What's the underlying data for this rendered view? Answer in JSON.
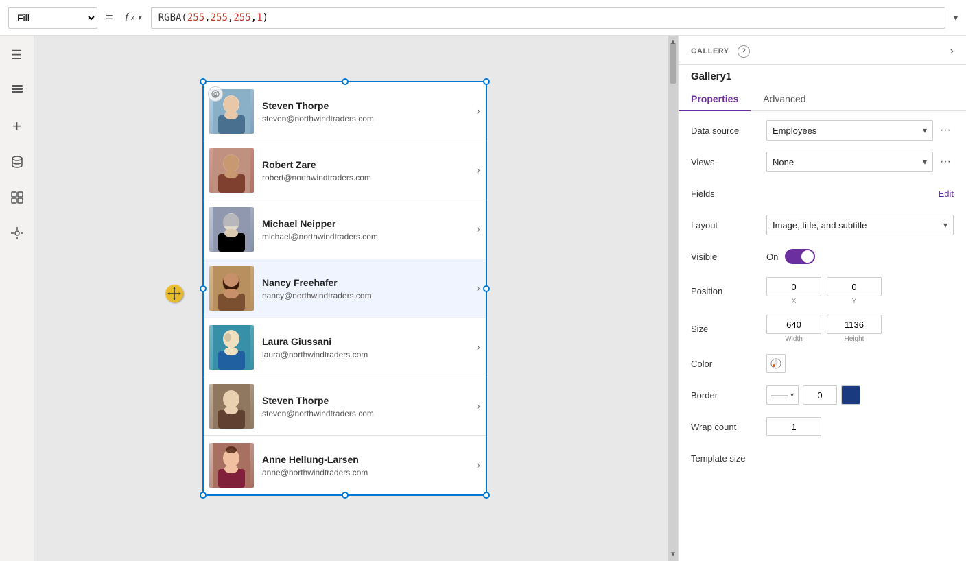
{
  "toolbar": {
    "fill_label": "Fill",
    "equals_symbol": "=",
    "fx_label": "fx",
    "formula": "RGBA(255, 255, 255, 1)",
    "formula_parts": [
      "RGBA(",
      "255",
      ", ",
      "255",
      ", ",
      "255",
      ", ",
      "1",
      ")"
    ],
    "dropdown_arrow": "▾"
  },
  "sidebar": {
    "icons": [
      {
        "name": "hamburger-icon",
        "symbol": "☰"
      },
      {
        "name": "layers-icon",
        "symbol": "⊞"
      },
      {
        "name": "plus-icon",
        "symbol": "+"
      },
      {
        "name": "database-icon",
        "symbol": "🗄"
      },
      {
        "name": "components-icon",
        "symbol": "⊡"
      },
      {
        "name": "tools-icon",
        "symbol": "🔧"
      }
    ]
  },
  "gallery": {
    "items": [
      {
        "name": "Steven Thorpe",
        "email": "steven@northwindtraders.com",
        "avatar_color": "avatar-1"
      },
      {
        "name": "Robert Zare",
        "email": "robert@northwindtraders.com",
        "avatar_color": "avatar-2"
      },
      {
        "name": "Michael Neipper",
        "email": "michael@northwindtraders.com",
        "avatar_color": "avatar-3"
      },
      {
        "name": "Nancy Freehafer",
        "email": "nancy@northwindtraders.com",
        "avatar_color": "avatar-4",
        "selected": true
      },
      {
        "name": "Laura Giussani",
        "email": "laura@northwindtraders.com",
        "avatar_color": "avatar-5"
      },
      {
        "name": "Steven Thorpe",
        "email": "steven@northwindtraders.com",
        "avatar_color": "avatar-6"
      },
      {
        "name": "Anne Hellung-Larsen",
        "email": "anne@northwindtraders.com",
        "avatar_color": "avatar-7"
      }
    ]
  },
  "right_panel": {
    "section_label": "GALLERY",
    "help_icon": "?",
    "gallery_name": "Gallery1",
    "tabs": [
      {
        "label": "Properties",
        "active": true
      },
      {
        "label": "Advanced",
        "active": false
      }
    ],
    "properties": {
      "data_source_label": "Data source",
      "data_source_value": "Employees",
      "views_label": "Views",
      "views_value": "None",
      "fields_label": "Fields",
      "fields_edit": "Edit",
      "layout_label": "Layout",
      "layout_value": "Image, title, and subtitle",
      "visible_label": "Visible",
      "visible_value": "On",
      "position_label": "Position",
      "pos_x": "0",
      "pos_y": "0",
      "pos_x_label": "X",
      "pos_y_label": "Y",
      "size_label": "Size",
      "size_w": "640",
      "size_h": "1136",
      "size_w_label": "Width",
      "size_h_label": "Height",
      "color_label": "Color",
      "color_icon": "🎨",
      "border_label": "Border",
      "border_value": "0",
      "wrap_count_label": "Wrap count",
      "wrap_count_value": "1",
      "template_label": "Template size"
    }
  }
}
